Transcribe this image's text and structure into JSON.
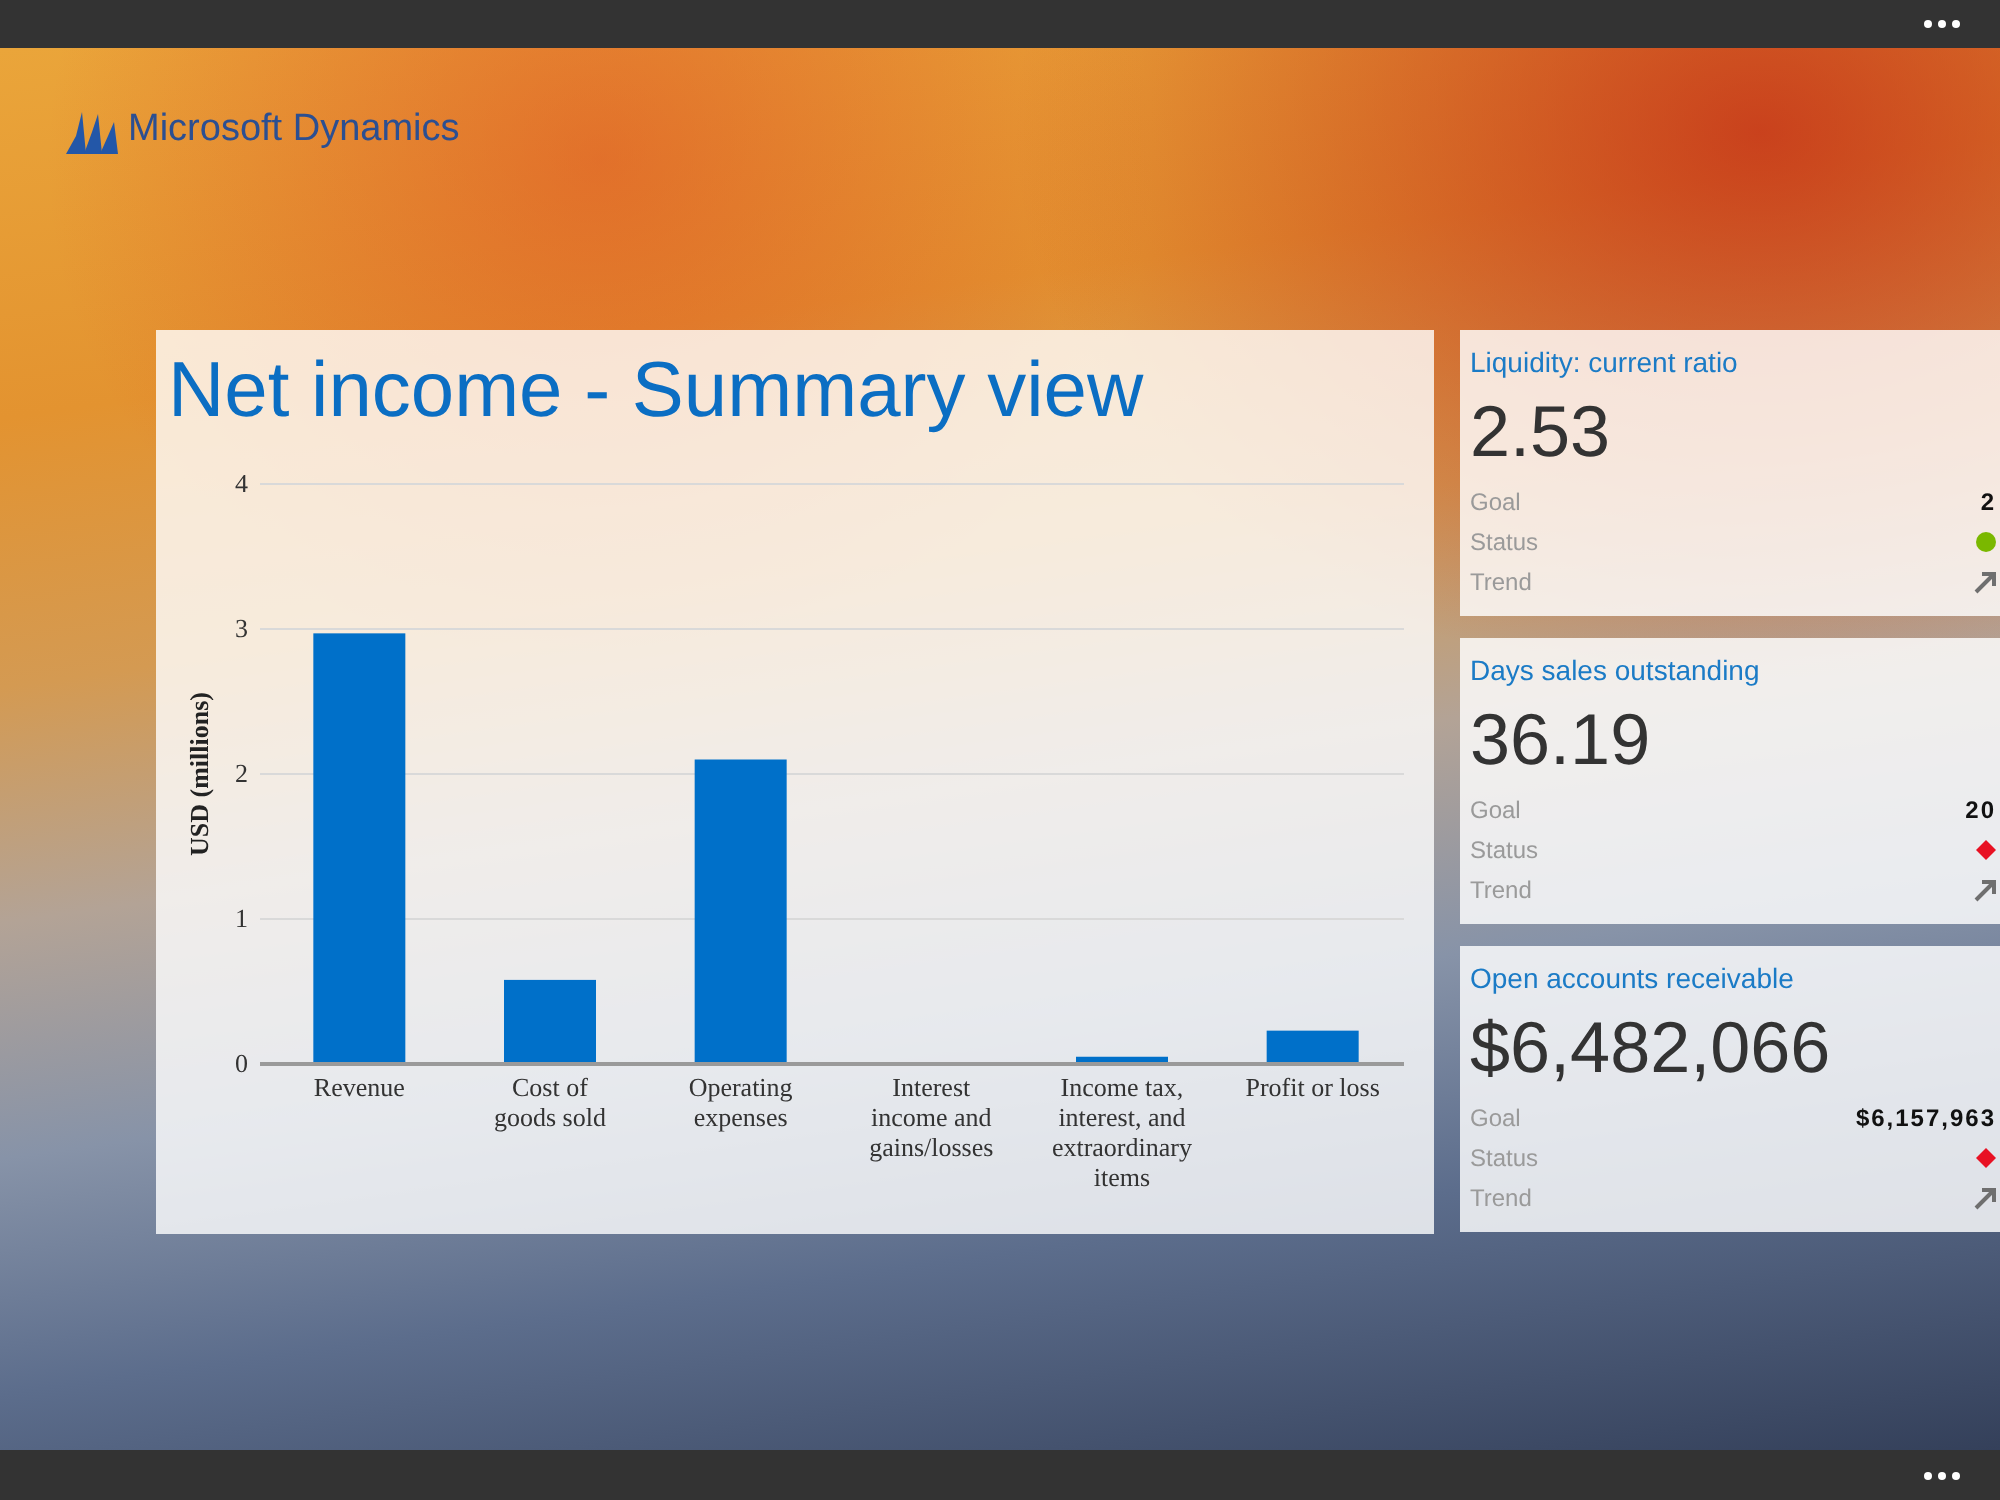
{
  "logo": {
    "text": "Microsoft Dynamics"
  },
  "chart_panel": {
    "chart_data": {
      "type": "bar",
      "title": "Net income - Summary view",
      "ylabel": "USD (millions)",
      "categories": [
        "Revenue",
        "Cost of goods sold",
        "Operating expenses",
        "Interest income and gains/losses",
        "Income tax, interest, and extraordinary items",
        "Profit or loss"
      ],
      "values": [
        2.97,
        0.58,
        2.1,
        0,
        0.05,
        0.23
      ],
      "ylim": [
        0,
        4
      ],
      "yticks": [
        0,
        1,
        2,
        3,
        4
      ],
      "grid": true
    }
  },
  "kpis": [
    {
      "title": "Liquidity: current ratio",
      "value": "2.53",
      "goal_label": "Goal",
      "goal": "2",
      "status_label": "Status",
      "on_target": true,
      "trend_label": "Trend"
    },
    {
      "title": "Days sales outstanding",
      "value": "36.19",
      "goal_label": "Goal",
      "goal": "20",
      "status_label": "Status",
      "on_target": false,
      "trend_label": "Trend"
    },
    {
      "title": "Open accounts receivable",
      "value": "$6,482,066",
      "goal_label": "Goal",
      "goal": "$6,157,963",
      "status_label": "Status",
      "on_target": false,
      "trend_label": "Trend"
    }
  ]
}
